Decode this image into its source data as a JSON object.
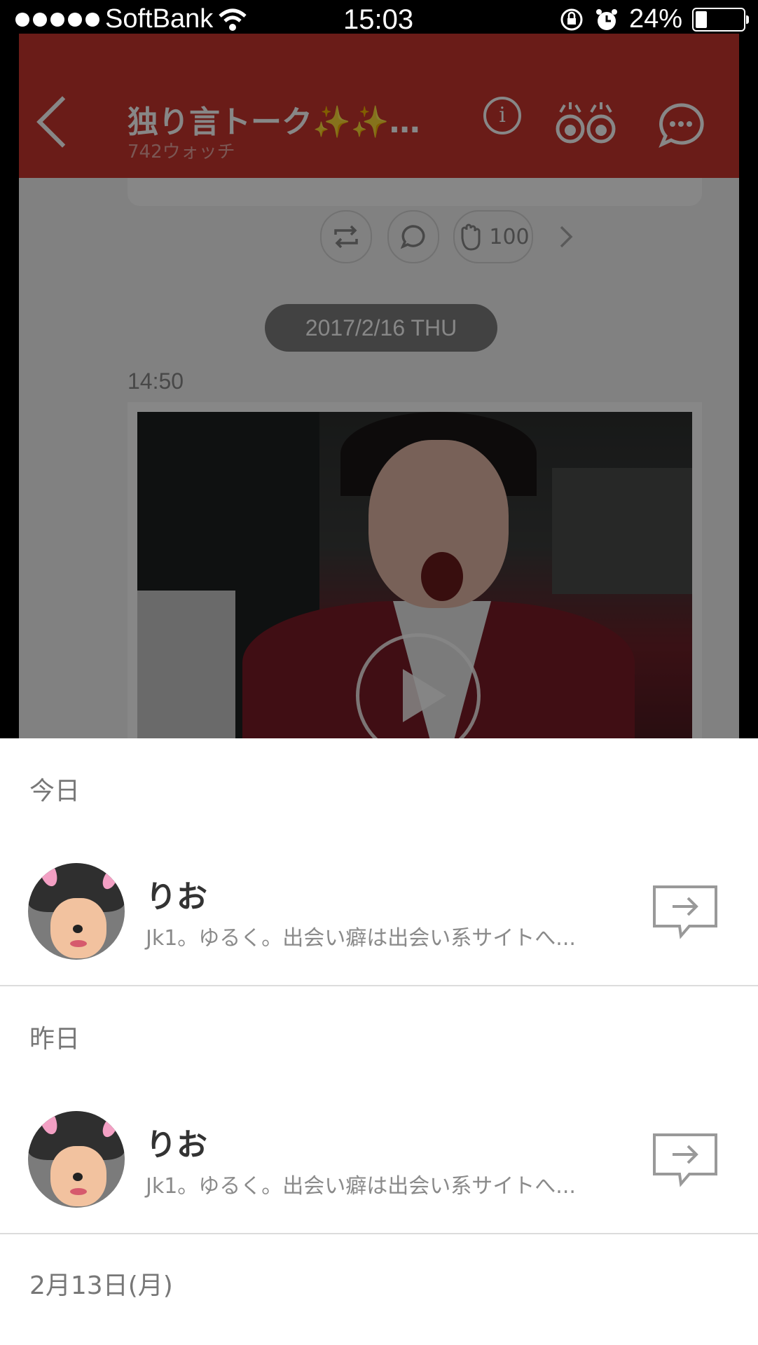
{
  "status_bar": {
    "carrier": "SoftBank",
    "time": "15:03",
    "battery_percent": "24%",
    "battery_level": 0.24,
    "icons": [
      "signal-dots-icon",
      "wifi-icon",
      "orientation-lock-icon",
      "alarm-icon",
      "battery-icon"
    ]
  },
  "background_app": {
    "title": "独り言トーク✨✨…",
    "subtitle": "742ウォッチ",
    "nav_color": "#c9362f",
    "reaction_count": "100",
    "date_pill": "2017/2/16 THU",
    "post_time": "14:50"
  },
  "sheet": {
    "sections": [
      {
        "header": "今日",
        "name": "りお",
        "description": "Jk1。ゆるく。出会い癖は出会い系サイトへ..."
      },
      {
        "header": "昨日",
        "name": "りお",
        "description": "Jk1。ゆるく。出会い癖は出会い系サイトへ..."
      }
    ],
    "next_header": "2月13日(月)"
  }
}
